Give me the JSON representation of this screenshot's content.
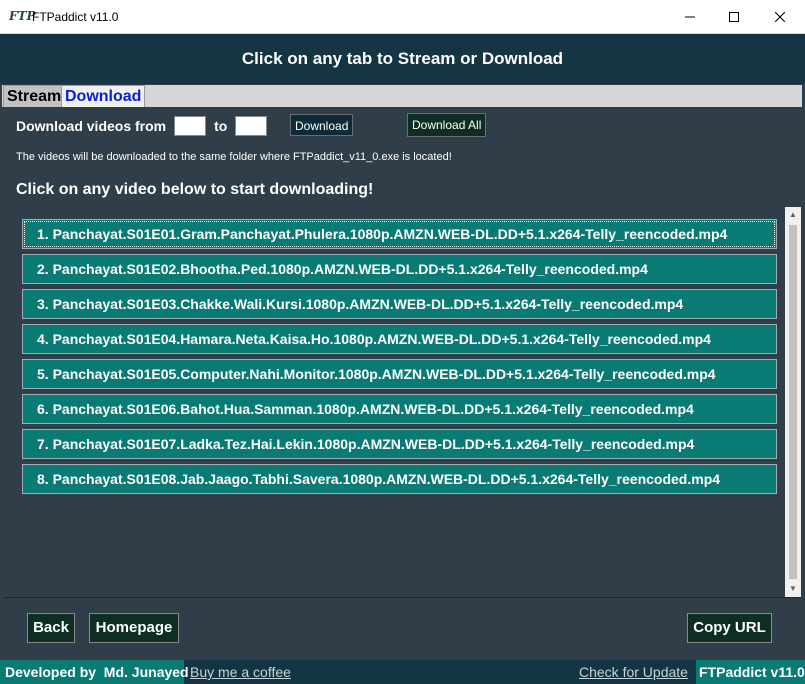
{
  "window": {
    "logo": "FTP",
    "title": "FTPaddict v11.0",
    "controls": [
      "minimize",
      "maximize",
      "close"
    ]
  },
  "header": {
    "text": "Click on any tab to Stream or Download"
  },
  "tabs": [
    {
      "label": "Stream",
      "selected": false
    },
    {
      "label": "Download",
      "selected": true
    }
  ],
  "download_panel": {
    "range_label": "Download videos from",
    "to_label": "to",
    "from_value": "",
    "to_value": "",
    "download_button": "Download",
    "download_all_button": "Download All",
    "note": "The videos will be downloaded to the same folder where FTPaddict_v11_0.exe is located!",
    "instruction": "Click on any video below to start downloading!",
    "videos": [
      "1. Panchayat.S01E01.Gram.Panchayat.Phulera.1080p.AMZN.WEB-DL.DD+5.1.x264-Telly_reencoded.mp4",
      "2. Panchayat.S01E02.Bhootha.Ped.1080p.AMZN.WEB-DL.DD+5.1.x264-Telly_reencoded.mp4",
      "3. Panchayat.S01E03.Chakke.Wali.Kursi.1080p.AMZN.WEB-DL.DD+5.1.x264-Telly_reencoded.mp4",
      "4. Panchayat.S01E04.Hamara.Neta.Kaisa.Ho.1080p.AMZN.WEB-DL.DD+5.1.x264-Telly_reencoded.mp4",
      "5. Panchayat.S01E05.Computer.Nahi.Monitor.1080p.AMZN.WEB-DL.DD+5.1.x264-Telly_reencoded.mp4",
      "6. Panchayat.S01E06.Bahot.Hua.Samman.1080p.AMZN.WEB-DL.DD+5.1.x264-Telly_reencoded.mp4",
      "7. Panchayat.S01E07.Ladka.Tez.Hai.Lekin.1080p.AMZN.WEB-DL.DD+5.1.x264-Telly_reencoded.mp4",
      "8. Panchayat.S01E08.Jab.Jaago.Tabhi.Savera.1080p.AMZN.WEB-DL.DD+5.1.x264-Telly_reencoded.mp4"
    ]
  },
  "bottom_buttons": {
    "back": "Back",
    "homepage": "Homepage",
    "copy_url": "Copy URL"
  },
  "footer": {
    "developer": "Developed by  Md. Junayed",
    "coffee_link": "Buy me a coffee",
    "update_link": "Check for Update",
    "version": "FTPaddict v11.0"
  },
  "colors": {
    "header_bg": "#153444",
    "panel_bg": "#2f3e48",
    "item_bg": "#0a7a74",
    "button_green": "#0e2e23",
    "tab_link": "#0a1ed6"
  }
}
